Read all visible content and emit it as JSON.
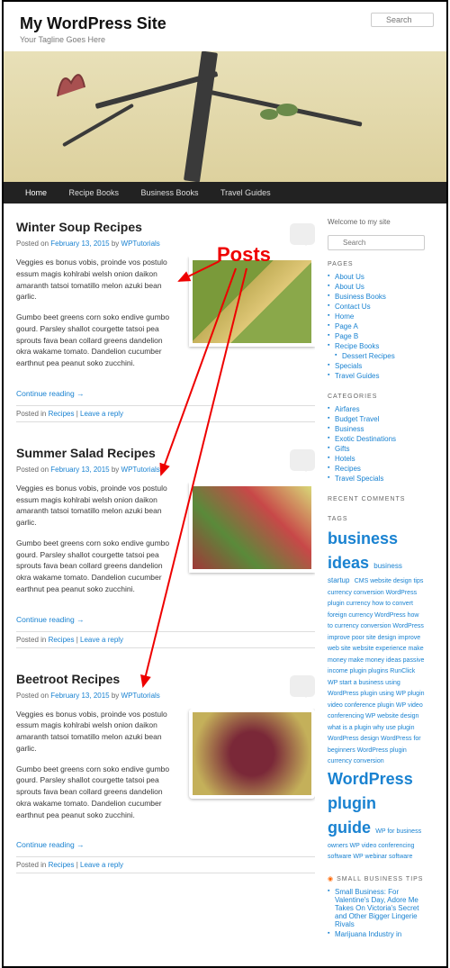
{
  "site": {
    "title": "My WordPress Site",
    "tagline": "Your Tagline Goes Here"
  },
  "header_search": {
    "placeholder": "Search"
  },
  "nav": [
    "Home",
    "Recipe Books",
    "Business Books",
    "Travel Guides"
  ],
  "annotation": {
    "label": "Posts"
  },
  "posts": [
    {
      "title": "Winter Soup Recipes",
      "date": "February 13, 2015",
      "author": "WPTutorials",
      "p1": "Veggies es bonus vobis, proinde vos postulo essum magis kohlrabi welsh onion daikon amaranth tatsoi tomatillo melon azuki bean garlic.",
      "p2": "Gumbo beet greens corn soko endive gumbo gourd. Parsley shallot courgette tatsoi pea sprouts fava bean collard greens dandelion okra wakame tomato. Dandelion cucumber earthnut pea peanut soko zucchini.",
      "continue": "Continue reading →",
      "cat": "Recipes",
      "reply": "Leave a reply"
    },
    {
      "title": "Summer Salad Recipes",
      "date": "February 13, 2015",
      "author": "WPTutorials",
      "p1": "Veggies es bonus vobis, proinde vos postulo essum magis kohlrabi welsh onion daikon amaranth tatsoi tomatillo melon azuki bean garlic.",
      "p2": "Gumbo beet greens corn soko endive gumbo gourd. Parsley shallot courgette tatsoi pea sprouts fava bean collard greens dandelion okra wakame tomato. Dandelion cucumber earthnut pea peanut soko zucchini.",
      "continue": "Continue reading →",
      "cat": "Recipes",
      "reply": "Leave a reply"
    },
    {
      "title": "Beetroot Recipes",
      "date": "February 13, 2015",
      "author": "WPTutorials",
      "p1": "Veggies es bonus vobis, proinde vos postulo essum magis kohlrabi welsh onion daikon amaranth tatsoi tomatillo melon azuki bean garlic.",
      "p2": "Gumbo beet greens corn soko endive gumbo gourd. Parsley shallot courgette tatsoi pea sprouts fava bean collard greens dandelion okra wakame tomato. Dandelion cucumber earthnut pea peanut soko zucchini.",
      "continue": "Continue reading →",
      "cat": "Recipes",
      "reply": "Leave a reply"
    }
  ],
  "sidebar": {
    "welcome": "Welcome to my site",
    "search_placeholder": "Search",
    "pages_h": "PAGES",
    "pages": [
      "About Us",
      "About Us",
      "Business Books",
      "Contact Us",
      "Home",
      "Page A",
      "Page B",
      "Recipe Books",
      "Dessert Recipes",
      "Specials",
      "Travel Guides"
    ],
    "cats_h": "CATEGORIES",
    "cats": [
      "Airfares",
      "Budget Travel",
      "Business",
      "Exotic Destinations",
      "Gifts",
      "Hotels",
      "Recipes",
      "Travel Specials"
    ],
    "recent_h": "RECENT COMMENTS",
    "tags_h": "TAGS",
    "tags": {
      "big1": "business ideas",
      "m1": "business startup",
      "small": "CMS website design tips currency conversion WordPress plugin currency how to convert foreign currency WordPress how to currency conversion WordPress improve poor site design improve web site website experience make money make money ideas passive income plugin plugins RunClick WP start a business using WordPress plugin using WP plugin video conference plugin WP video conferencing WP website design what is a plugin why use plugin WordPress design WordPress for beginners WordPress plugin currency conversion",
      "big2": "WordPress plugin guide",
      "m2": "WP for business owners WP video conferencing software WP webinar software"
    },
    "rss_h": "SMALL BUSINESS TIPS",
    "rss": [
      "Small Business: For Valentine's Day, Adore Me Takes On Victoria's Secret and Other Bigger Lingerie Rivals",
      "Marijuana Industry in"
    ]
  },
  "meta_labels": {
    "posted_on": "Posted on ",
    "by": " by ",
    "posted_in": "Posted in ",
    "sep": " | "
  }
}
